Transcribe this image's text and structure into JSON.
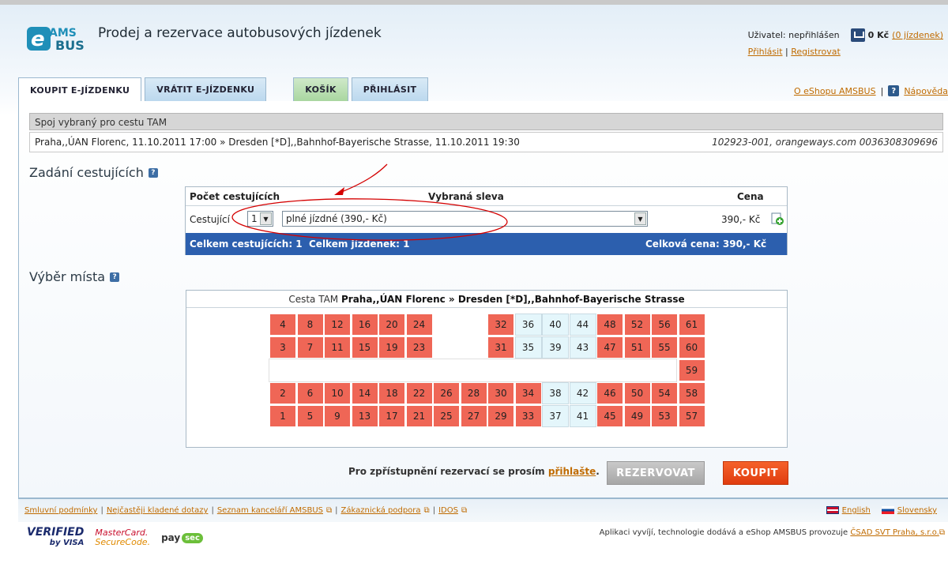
{
  "header": {
    "logo_text": "eAMSBUS",
    "site_title": "Prodej a rezervace autobusových jízdenek",
    "user_label": "Uživatel: nepřihlášen",
    "cart_amount": "0 Kč",
    "cart_tickets": "(0 jízdenek)",
    "login_link": "Přihlásit",
    "register_link": "Registrovat",
    "separator": "|"
  },
  "tabs": [
    {
      "label": "KOUPIT E-JÍZDENKU",
      "state": "active"
    },
    {
      "label": "VRÁTIT E-JÍZDENKU",
      "state": "inactive"
    },
    {
      "label": "KOŠÍK",
      "state": "inactive"
    },
    {
      "label": "PŘIHLÁSIT",
      "state": "inactive"
    }
  ],
  "toplinks": {
    "about": "O eShopu AMSBUS",
    "help": "Nápověda"
  },
  "connection": {
    "header": "Spoj vybraný pro cestu TAM",
    "route": "Praha,,ÚAN Florenc, 11.10.2011 17:00 » Dresden [*D],,Bahnhof-Bayerische Strasse, 11.10.2011 19:30",
    "carrier": "102923-001, orangeways.com 0036308309696"
  },
  "passengers": {
    "section_title": "Zadání cestujících",
    "col_count": "Počet cestujících",
    "col_discount": "Vybraná sleva",
    "col_price": "Cena",
    "row_label": "Cestující",
    "count_value": "1",
    "discount_value": "plné jízdné (390,-  Kč)",
    "price": "390,-  Kč",
    "total_passengers": "Celkem cestujících: 1",
    "total_tickets": "Celkem jízdenek: 1",
    "total_price": "Celková cena: 390,-  Kč"
  },
  "seats": {
    "section_title": "Výběr místa",
    "caption_prefix": "Cesta TAM",
    "caption_route": "Praha,,ÚAN Florenc » Dresden [*D],,Bahnhof-Bayerische Strasse",
    "rows": [
      [
        {
          "n": "4",
          "s": "taken"
        },
        {
          "n": "8",
          "s": "taken"
        },
        {
          "n": "12",
          "s": "taken"
        },
        {
          "n": "16",
          "s": "taken"
        },
        {
          "n": "20",
          "s": "taken"
        },
        {
          "n": "24",
          "s": "taken"
        },
        null,
        null,
        {
          "n": "32",
          "s": "taken"
        },
        {
          "n": "36",
          "s": "free"
        },
        {
          "n": "40",
          "s": "free"
        },
        {
          "n": "44",
          "s": "free"
        },
        {
          "n": "48",
          "s": "taken"
        },
        {
          "n": "52",
          "s": "taken"
        },
        {
          "n": "56",
          "s": "taken"
        },
        {
          "n": "61",
          "s": "taken"
        }
      ],
      [
        {
          "n": "3",
          "s": "taken"
        },
        {
          "n": "7",
          "s": "taken"
        },
        {
          "n": "11",
          "s": "taken"
        },
        {
          "n": "15",
          "s": "taken"
        },
        {
          "n": "19",
          "s": "taken"
        },
        {
          "n": "23",
          "s": "taken"
        },
        null,
        null,
        {
          "n": "31",
          "s": "taken"
        },
        {
          "n": "35",
          "s": "free"
        },
        {
          "n": "39",
          "s": "free"
        },
        {
          "n": "43",
          "s": "free"
        },
        {
          "n": "47",
          "s": "taken"
        },
        {
          "n": "51",
          "s": "taken"
        },
        {
          "n": "55",
          "s": "taken"
        },
        {
          "n": "60",
          "s": "taken"
        }
      ],
      [
        null,
        null,
        null,
        null,
        null,
        null,
        null,
        null,
        null,
        null,
        null,
        null,
        null,
        null,
        null,
        {
          "n": "59",
          "s": "taken"
        }
      ],
      [
        {
          "n": "2",
          "s": "taken"
        },
        {
          "n": "6",
          "s": "taken"
        },
        {
          "n": "10",
          "s": "taken"
        },
        {
          "n": "14",
          "s": "taken"
        },
        {
          "n": "18",
          "s": "taken"
        },
        {
          "n": "22",
          "s": "taken"
        },
        {
          "n": "26",
          "s": "taken"
        },
        {
          "n": "28",
          "s": "taken"
        },
        {
          "n": "30",
          "s": "taken"
        },
        {
          "n": "34",
          "s": "taken"
        },
        {
          "n": "38",
          "s": "free"
        },
        {
          "n": "42",
          "s": "free"
        },
        {
          "n": "46",
          "s": "taken"
        },
        {
          "n": "50",
          "s": "taken"
        },
        {
          "n": "54",
          "s": "taken"
        },
        {
          "n": "58",
          "s": "taken"
        }
      ],
      [
        {
          "n": "1",
          "s": "taken"
        },
        {
          "n": "5",
          "s": "taken"
        },
        {
          "n": "9",
          "s": "taken"
        },
        {
          "n": "13",
          "s": "taken"
        },
        {
          "n": "17",
          "s": "taken"
        },
        {
          "n": "21",
          "s": "taken"
        },
        {
          "n": "25",
          "s": "taken"
        },
        {
          "n": "27",
          "s": "taken"
        },
        {
          "n": "29",
          "s": "taken"
        },
        {
          "n": "33",
          "s": "taken"
        },
        {
          "n": "37",
          "s": "free"
        },
        {
          "n": "41",
          "s": "free"
        },
        {
          "n": "45",
          "s": "taken"
        },
        {
          "n": "49",
          "s": "taken"
        },
        {
          "n": "53",
          "s": "taken"
        },
        {
          "n": "57",
          "s": "taken"
        }
      ]
    ]
  },
  "actions": {
    "note_text": "Pro zpřístupnění rezervací se prosím",
    "note_link": "přihlašte",
    "note_end": ".",
    "reserve_label": "REZERVOVAT",
    "buy_label": "KOUPIT"
  },
  "footer": {
    "links": [
      "Smluvní podmínky",
      "Nejčastěji kladené dotazy",
      "Seznam kanceláří AMSBUS",
      "Zákaznická podpora",
      "IDOS"
    ],
    "lang_en": "English",
    "lang_sk": "Slovensky",
    "credit_text": "Aplikaci vyvíjí, technologie dodává a eShop AMSBUS provozuje",
    "credit_link": "ČSAD SVT Praha, s.r.o."
  },
  "badges": {
    "visa_main": "VERIFIED",
    "visa_sub": "by VISA",
    "mc_main": "MasterCard.",
    "mc_sub": "SecureCode.",
    "paysec_a": "pay",
    "paysec_b": "sec"
  },
  "colors": {
    "seat_taken": "#ef6656",
    "seat_free": "#e4f6fb",
    "summary_bar": "#2c5fae",
    "buy_button": "#e8461a",
    "annotation_red": "#d40000"
  }
}
